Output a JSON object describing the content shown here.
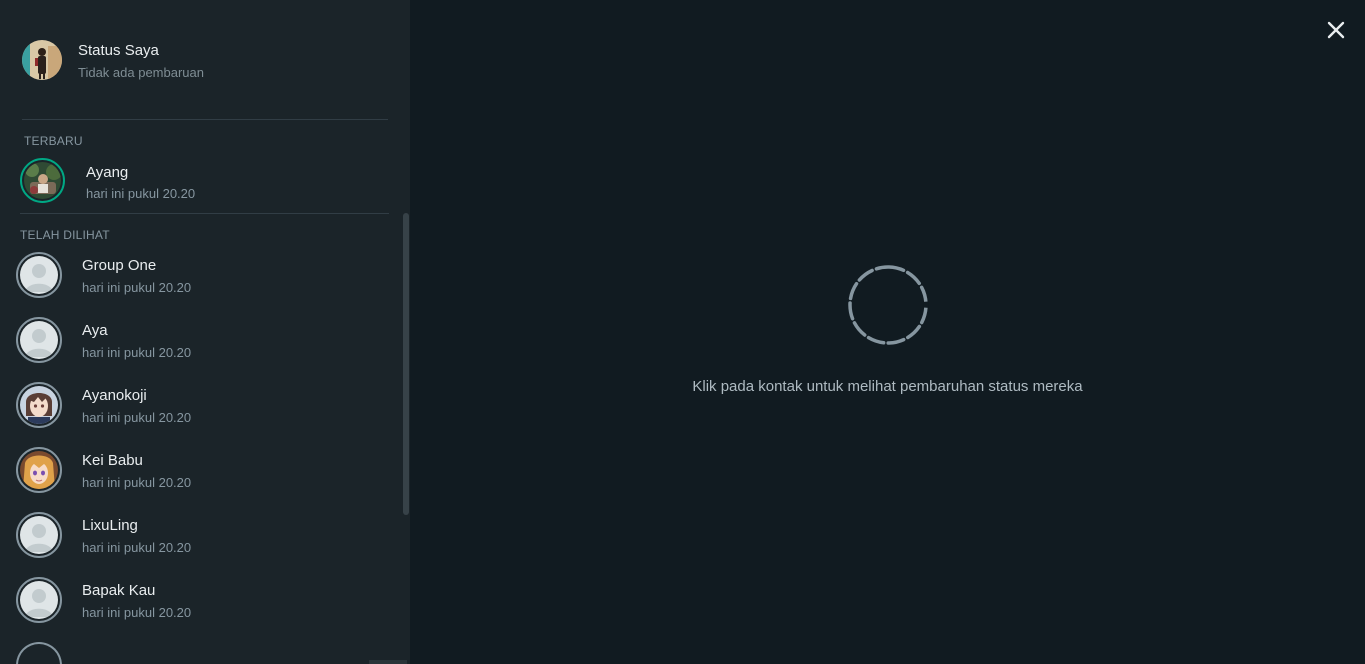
{
  "my_status": {
    "name": "Status Saya",
    "subtitle": "Tidak ada pembaruan"
  },
  "recent": {
    "label": "TERBARU",
    "items": [
      {
        "name": "Ayang",
        "time": "hari ini pukul 20.20"
      }
    ]
  },
  "viewed": {
    "label": "TELAH DILIHAT",
    "items": [
      {
        "name": "Group One",
        "time": "hari ini pukul 20.20",
        "avatar": "default-avatar"
      },
      {
        "name": "Aya",
        "time": "hari ini pukul 20.20",
        "avatar": "default-avatar"
      },
      {
        "name": "Ayanokoji",
        "time": "hari ini pukul 20.20",
        "avatar": "anime-boy-photo"
      },
      {
        "name": "Kei Babu",
        "time": "hari ini pukul 20.20",
        "avatar": "anime-girl-photo"
      },
      {
        "name": "LixuLing",
        "time": "hari ini pukul 20.20",
        "avatar": "default-avatar"
      },
      {
        "name": "Bapak Kau",
        "time": "hari ini pukul 20.20",
        "avatar": "default-avatar"
      }
    ]
  },
  "main": {
    "hint": "Klik pada kontak untuk melihat pembaruhan status mereka"
  },
  "icons": {
    "close": "close-icon",
    "loading": "loading-spinner-icon"
  },
  "colors": {
    "accent_ring": "#00a884",
    "viewed_ring": "#8696a0",
    "sidebar_bg": "#1b2429",
    "main_bg": "#111b21"
  }
}
